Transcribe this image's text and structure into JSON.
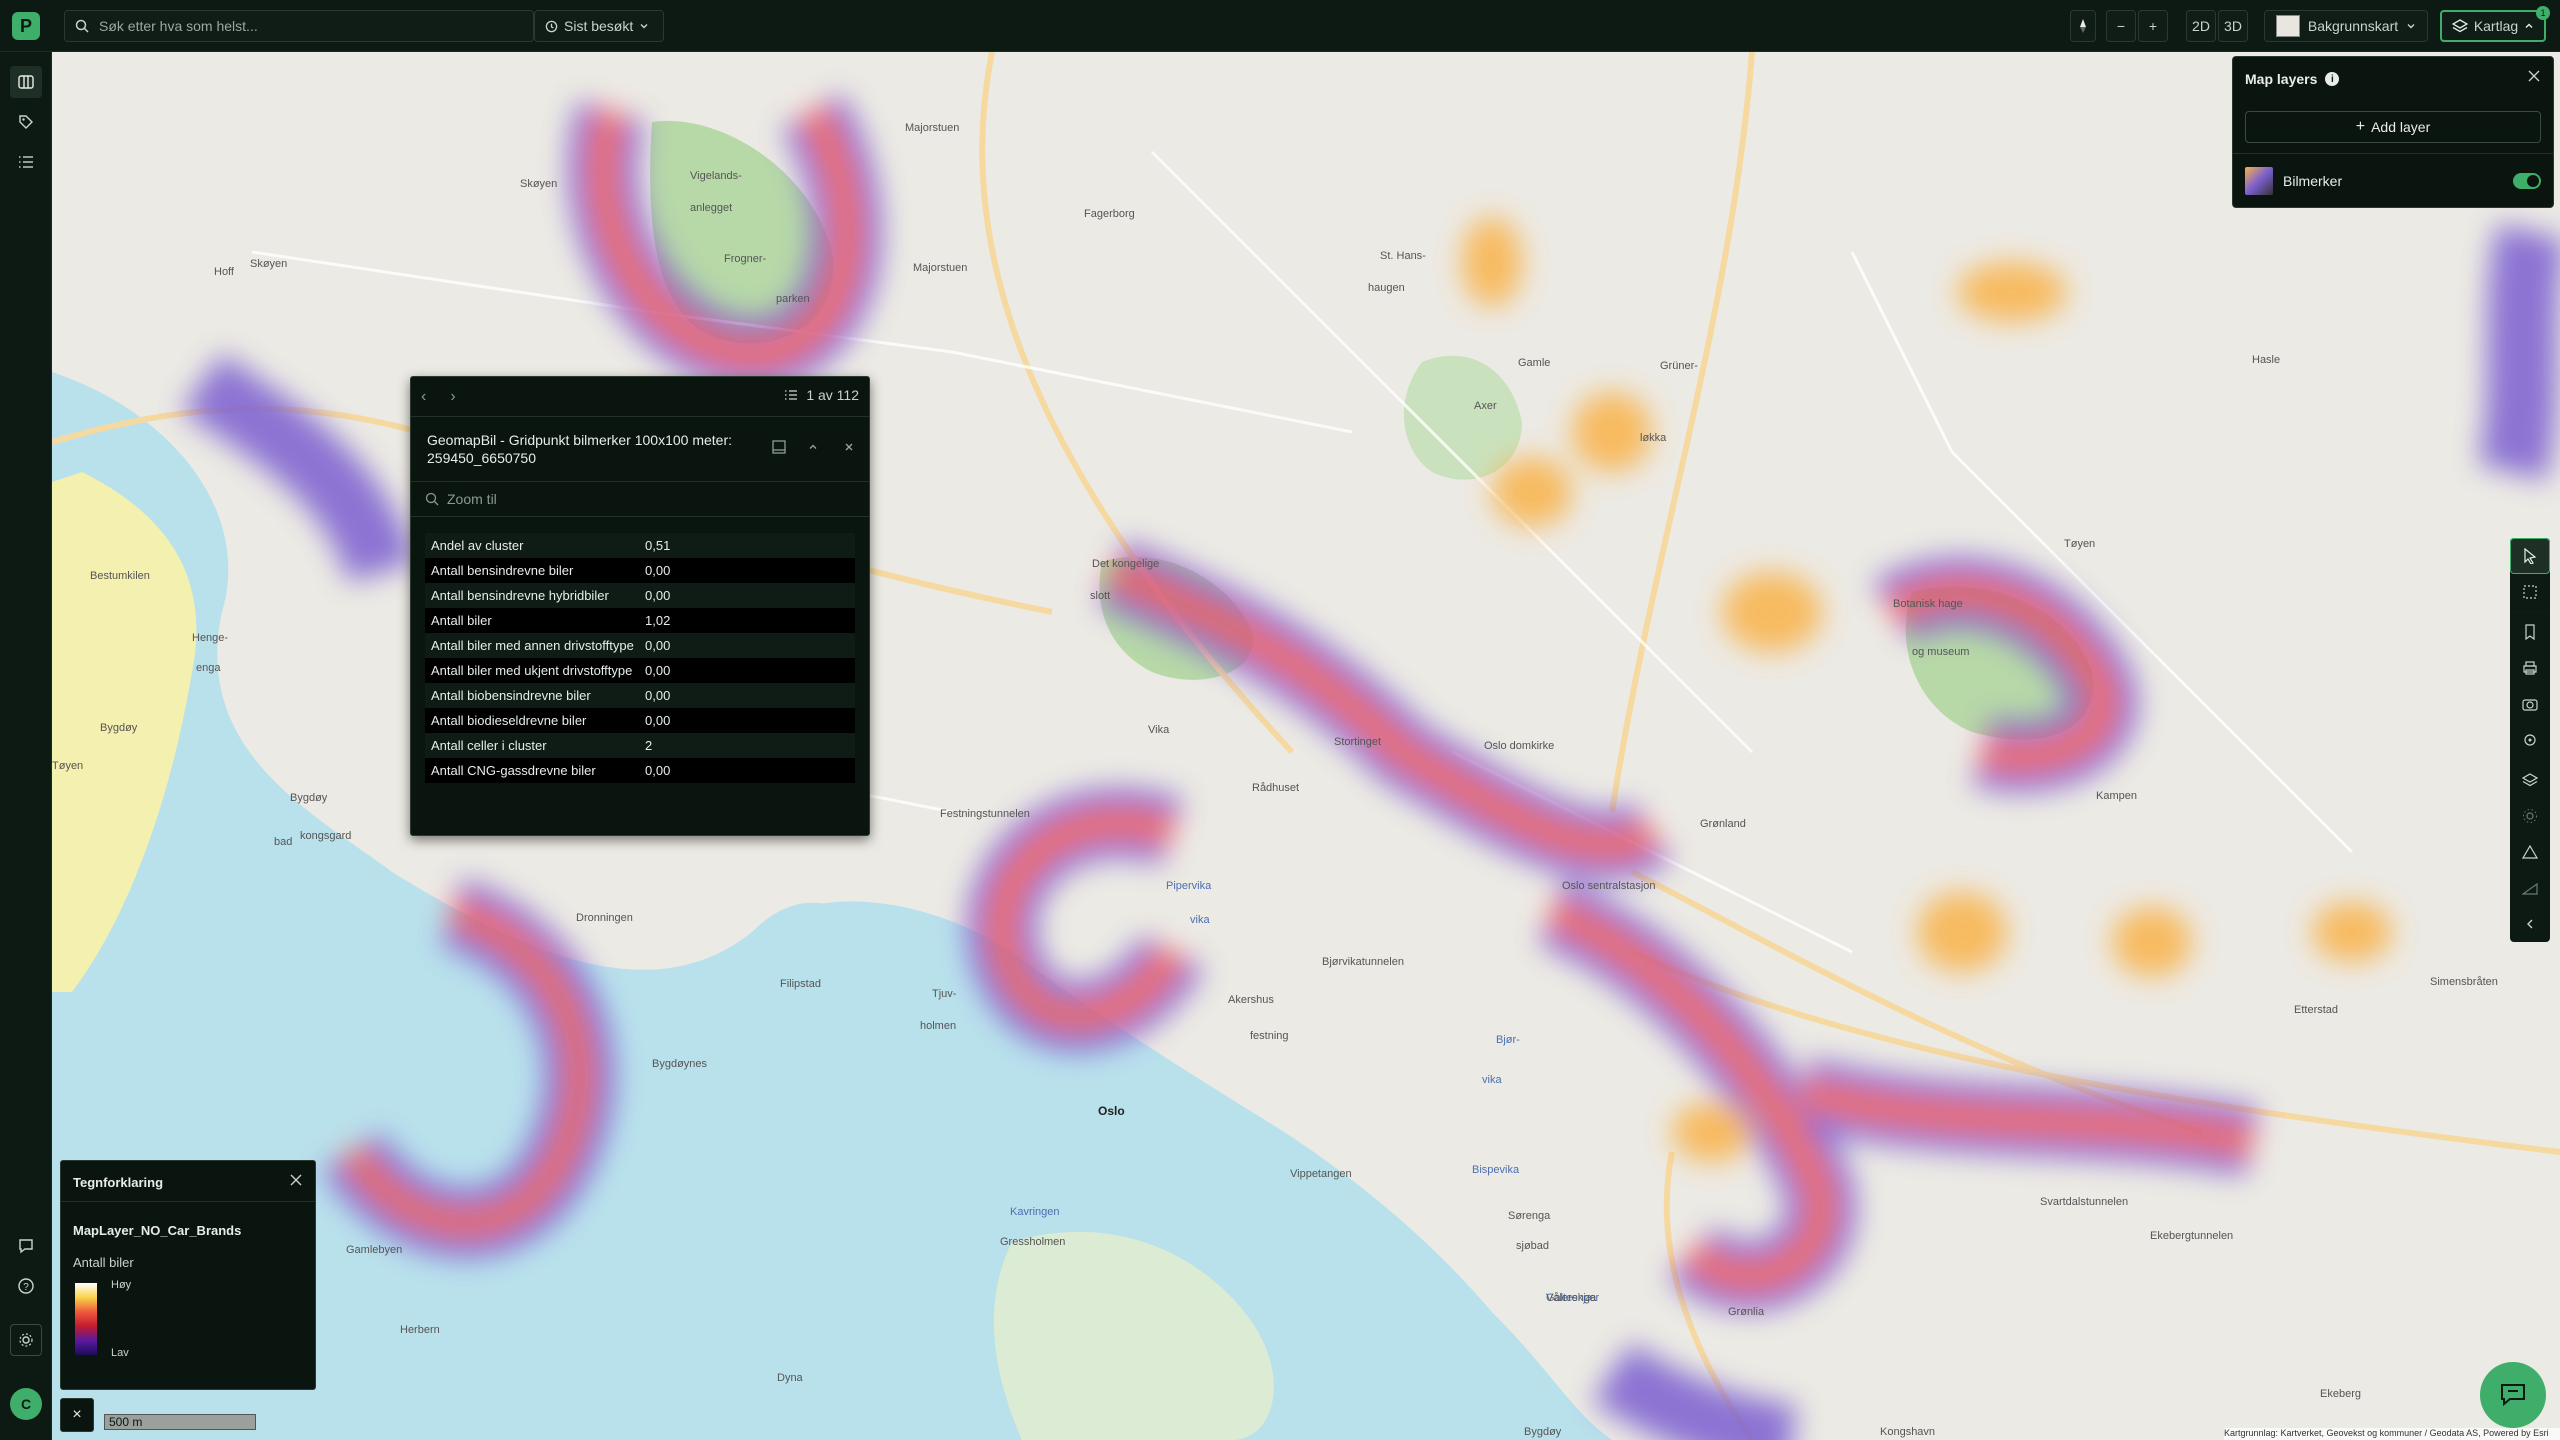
{
  "topbar": {
    "logo_letter": "P",
    "search_placeholder": "Søk etter hva som helst...",
    "recent_label": "Sist besøkt",
    "view_2d": "2D",
    "view_3d": "3D",
    "basemap_label": "Bakgrunnskart",
    "layers_label": "Kartlag",
    "layers_badge": "1"
  },
  "user": {
    "initial": "C"
  },
  "popup": {
    "count": "1 av 112",
    "title": "GeomapBil - Gridpunkt bilmerker 100x100 meter: 259450_6650750",
    "zoom_label": "Zoom til",
    "rows": [
      {
        "key": "Andel av cluster",
        "value": "0,51"
      },
      {
        "key": "Antall bensindrevne biler",
        "value": "0,00"
      },
      {
        "key": "Antall bensindrevne hybridbiler",
        "value": "0,00"
      },
      {
        "key": "Antall biler",
        "value": "1,02"
      },
      {
        "key": "Antall biler med annen drivstofftype",
        "value": "0,00"
      },
      {
        "key": "Antall biler med ukjent drivstofftype",
        "value": "0,00"
      },
      {
        "key": "Antall biobensindrevne biler",
        "value": "0,00"
      },
      {
        "key": "Antall biodieseldrevne biler",
        "value": "0,00"
      },
      {
        "key": "Antall celler i cluster",
        "value": "2"
      },
      {
        "key": "Antall CNG-gassdrevne biler",
        "value": "0,00"
      }
    ]
  },
  "layers_panel": {
    "title": "Map layers",
    "add_label": "Add layer",
    "layer_name": "Bilmerker",
    "layer_enabled": true
  },
  "legend": {
    "title": "Tegnforklaring",
    "layer": "MapLayer_NO_Car_Brands",
    "metric": "Antall biler",
    "high": "Høy",
    "low": "Lav"
  },
  "scale": {
    "label": "500 m"
  },
  "attribution": "Kartgrunnlag: Kartverket, Geovekst og kommuner / Geodata AS, Powered by Esri",
  "map_labels": [
    {
      "t": "Majorstuen"
    },
    {
      "t": "Vigelands-"
    },
    {
      "t": "anlegget"
    },
    {
      "t": "Frogner-"
    },
    {
      "t": "parken"
    },
    {
      "t": "Skøyen"
    },
    {
      "t": "Hoff"
    },
    {
      "t": "Skøyen"
    },
    {
      "t": "Fagerborg"
    },
    {
      "t": "Majorstuen"
    },
    {
      "t": "St. Hans-"
    },
    {
      "t": "haugen"
    },
    {
      "t": "Gamle"
    },
    {
      "t": "Grüner-"
    },
    {
      "t": "Axer"
    },
    {
      "t": "løkka"
    },
    {
      "t": "Hasle"
    },
    {
      "t": "Bestumkilen"
    },
    {
      "t": "Henge-"
    },
    {
      "t": "enga"
    },
    {
      "t": "Bygdøy"
    },
    {
      "t": "Bygdøy"
    },
    {
      "t": "Det kongelige"
    },
    {
      "t": "slott"
    },
    {
      "t": "Vika"
    },
    {
      "t": "Stortinget"
    },
    {
      "t": "Oslo domkirke"
    },
    {
      "t": "Rådhuset"
    },
    {
      "t": "Festningstunnelen"
    },
    {
      "t": "Botanisk hage"
    },
    {
      "t": "og museum"
    },
    {
      "t": "Tøyen"
    },
    {
      "t": "Grønland"
    },
    {
      "t": "Kampen"
    },
    {
      "t": "Oslo sentralstasjon"
    },
    {
      "t": "Bjørvikatunnelen"
    },
    {
      "t": "Akershus"
    },
    {
      "t": "festning"
    },
    {
      "t": "Pipervika",
      "blue": true
    },
    {
      "t": "vika",
      "blue": true
    },
    {
      "t": "Filipstad"
    },
    {
      "t": "Dronningen"
    },
    {
      "t": "Bygdøynes"
    },
    {
      "t": "Tjuv-"
    },
    {
      "t": "holmen"
    },
    {
      "t": "Oslo"
    },
    {
      "t": "Bjør-",
      "blue": true
    },
    {
      "t": "vika",
      "blue": true
    },
    {
      "t": "Vippetangen"
    },
    {
      "t": "Bispevika",
      "blue": true
    },
    {
      "t": "Sørenga"
    },
    {
      "t": "sjøbad"
    },
    {
      "t": "Kavringen",
      "blue": true
    },
    {
      "t": "Gressholmen"
    },
    {
      "t": "Galteskjær",
      "blue": true
    },
    {
      "t": "Dyna"
    },
    {
      "t": "Herbern"
    },
    {
      "t": "Gamlebyen"
    },
    {
      "t": "Svartdalstunnelen"
    },
    {
      "t": "Ekebergtunnelen"
    },
    {
      "t": "Grønlia"
    },
    {
      "t": "Vålerenga"
    },
    {
      "t": "Etterstad"
    },
    {
      "t": "Simensbråten"
    },
    {
      "t": "Ekeberg"
    },
    {
      "t": "Kongshavn"
    },
    {
      "t": "Bygdøy"
    },
    {
      "t": "kongsgard"
    },
    {
      "t": "bad"
    },
    {
      "t": "Tøyen"
    }
  ]
}
